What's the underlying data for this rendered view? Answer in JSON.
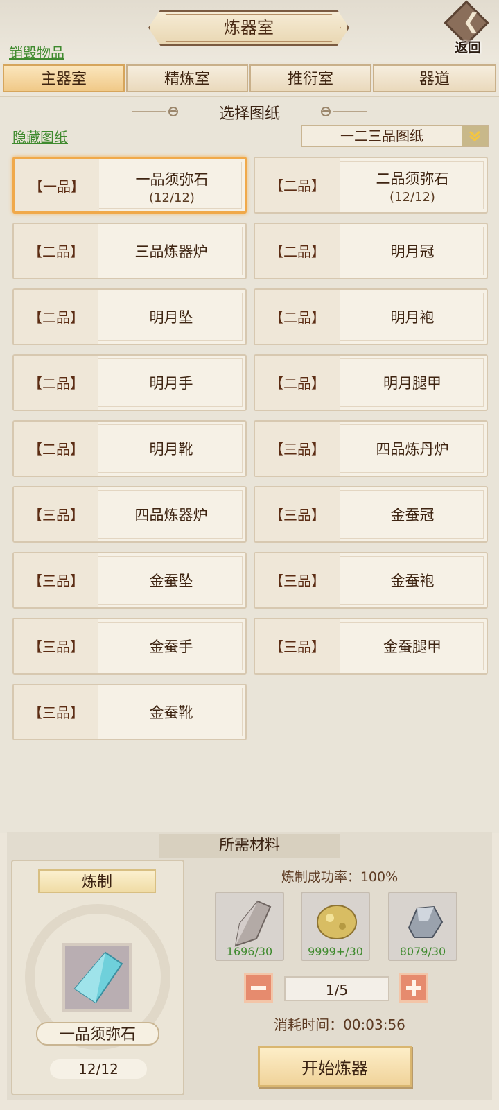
{
  "header": {
    "title": "炼器室",
    "back_label": "返回",
    "destroy_link": "销毁物品"
  },
  "tabs": [
    "主器室",
    "精炼室",
    "推衍室",
    "器道"
  ],
  "active_tab": 0,
  "blueprint_section": {
    "title": "选择图纸",
    "hide_link": "隐藏图纸",
    "grade_filter": "一二三品图纸"
  },
  "blueprints": [
    {
      "grade": "【一品】",
      "name": "一品须弥石",
      "count": "(12/12)",
      "selected": true
    },
    {
      "grade": "【二品】",
      "name": "二品须弥石",
      "count": "(12/12)",
      "selected": false
    },
    {
      "grade": "【二品】",
      "name": "三品炼器炉",
      "count": "",
      "selected": false
    },
    {
      "grade": "【二品】",
      "name": "明月冠",
      "count": "",
      "selected": false
    },
    {
      "grade": "【二品】",
      "name": "明月坠",
      "count": "",
      "selected": false
    },
    {
      "grade": "【二品】",
      "name": "明月袍",
      "count": "",
      "selected": false
    },
    {
      "grade": "【二品】",
      "name": "明月手",
      "count": "",
      "selected": false
    },
    {
      "grade": "【二品】",
      "name": "明月腿甲",
      "count": "",
      "selected": false
    },
    {
      "grade": "【二品】",
      "name": "明月靴",
      "count": "",
      "selected": false
    },
    {
      "grade": "【三品】",
      "name": "四品炼丹炉",
      "count": "",
      "selected": false
    },
    {
      "grade": "【三品】",
      "name": "四品炼器炉",
      "count": "",
      "selected": false
    },
    {
      "grade": "【三品】",
      "name": "金蚕冠",
      "count": "",
      "selected": false
    },
    {
      "grade": "【三品】",
      "name": "金蚕坠",
      "count": "",
      "selected": false
    },
    {
      "grade": "【三品】",
      "name": "金蚕袍",
      "count": "",
      "selected": false
    },
    {
      "grade": "【三品】",
      "name": "金蚕手",
      "count": "",
      "selected": false
    },
    {
      "grade": "【三品】",
      "name": "金蚕腿甲",
      "count": "",
      "selected": false
    },
    {
      "grade": "【三品】",
      "name": "金蚕靴",
      "count": "",
      "selected": false
    }
  ],
  "materials": {
    "title": "所需材料",
    "craft_label": "炼制",
    "crafted_item_name": "一品须弥石",
    "crafted_item_count": "12/12",
    "success_rate": "炼制成功率：100%",
    "items": [
      {
        "icon": "stone-shard-icon",
        "count": "1696/30"
      },
      {
        "icon": "gold-ore-icon",
        "count": "9999+/30"
      },
      {
        "icon": "iron-ore-icon",
        "count": "8079/30"
      }
    ],
    "quantity": "1/5",
    "time": "消耗时间：00:03:56",
    "start_button": "开始炼器"
  },
  "colors": {
    "accent_gold": "#f0a94a",
    "link_green": "#3f8a2e",
    "text_brown": "#5a3318",
    "stepper_red": "#e68b6e"
  }
}
